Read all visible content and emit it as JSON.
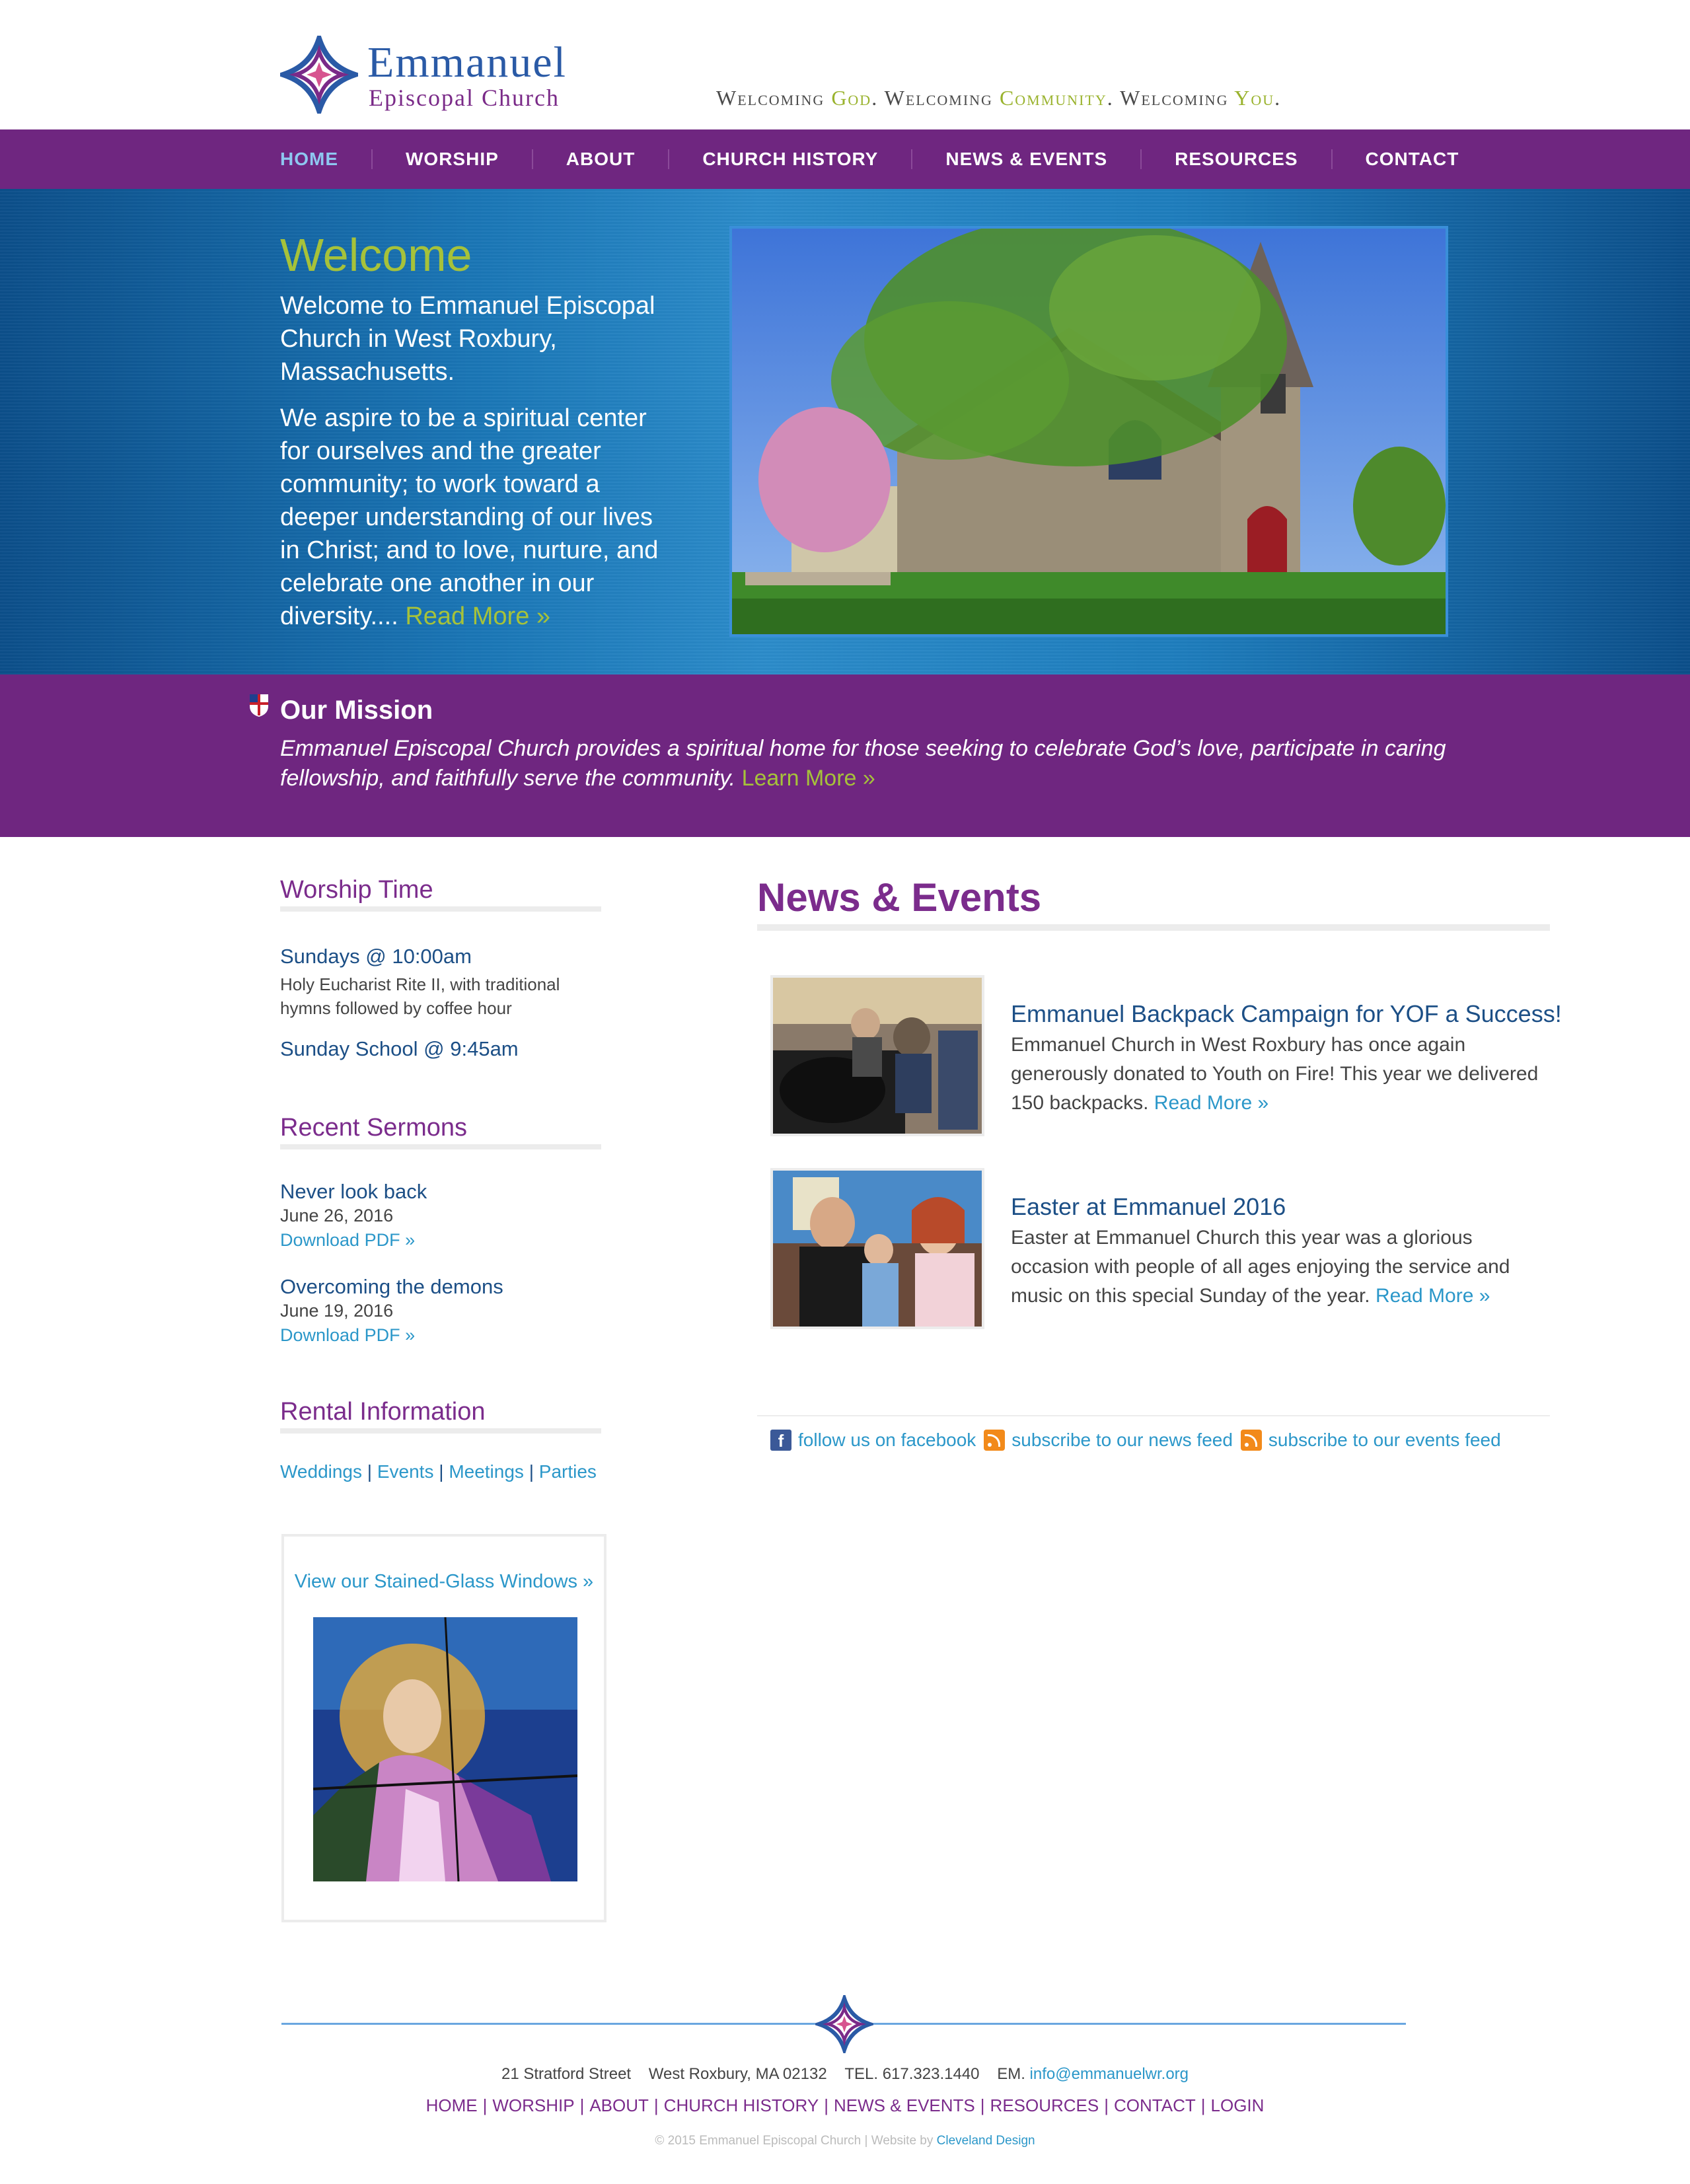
{
  "header": {
    "logo": {
      "name": "Emmanuel",
      "sub": "Episcopal Church"
    },
    "tagline": {
      "w1": "Welcoming ",
      "h1": "God",
      "p1": ". ",
      "w2": "Welcoming ",
      "h2": "Community",
      "p2": ". ",
      "w3": "Welcoming ",
      "h3": "You",
      "p3": "."
    }
  },
  "nav": {
    "items": [
      "HOME",
      "WORSHIP",
      "ABOUT",
      "CHURCH HISTORY",
      "NEWS & EVENTS",
      "RESOURCES",
      "CONTACT"
    ],
    "active": "HOME"
  },
  "hero": {
    "title": "Welcome",
    "intro": "Welcome to Emmanuel Episcopal Church in West Roxbury, Massachusetts.",
    "body": "We aspire to be a spiritual center for ourselves and the greater community; to work toward a deeper understanding of our lives in Christ; and to love, nurture, and celebrate one another in our diversity.... ",
    "read_more": "Read More »"
  },
  "mission": {
    "title": "Our Mission",
    "text": "Emmanuel Episcopal Church provides a spiritual home for those seeking to celebrate God’s love, participate in caring fellowship, and faithfully serve the community. ",
    "learn_more": "Learn More »"
  },
  "sidebar": {
    "worship": {
      "title": "Worship Time",
      "sunday": "Sundays @ 10:00am",
      "desc_line1": "Holy Eucharist Rite II, with traditional",
      "desc_line2": "hymns followed by coffee hour",
      "school": "Sunday School @ 9:45am"
    },
    "sermons": {
      "title": "Recent Sermons",
      "items": [
        {
          "title": "Never look back",
          "date": "June 26, 2016",
          "link": "Download PDF »"
        },
        {
          "title": "Overcoming the demons",
          "date": "June 19, 2016",
          "link": "Download PDF »"
        }
      ]
    },
    "rental": {
      "title": "Rental Information",
      "links": [
        "Weddings",
        "Events",
        "Meetings",
        "Parties"
      ],
      "sep": " | "
    },
    "stained": {
      "link": "View our Stained-Glass Windows »"
    }
  },
  "news": {
    "title": "News & Events",
    "items": [
      {
        "title": "Emmanuel Backpack Campaign for YOF a Success!",
        "text": "Emmanuel Church in West Roxbury has once again generously donated to Youth on Fire! This year we delivered 150 backpacks. ",
        "more": "Read More »"
      },
      {
        "title": "Easter at Emmanuel 2016",
        "text": "Easter at Emmanuel Church this year was a glorious occasion with people of all ages enjoying the service and music on this special Sunday of the year. ",
        "more": "Read More »"
      }
    ],
    "social": {
      "facebook": "follow us on facebook",
      "news_feed": "subscribe to our news feed",
      "events_feed": "subscribe to our events feed"
    }
  },
  "footer": {
    "street": "21 Stratford Street",
    "city": "West Roxbury, MA 02132",
    "tel": "TEL. 617.323.1440",
    "em_label": "EM.",
    "email": "info@emmanuelwr.org",
    "nav": [
      "HOME",
      "WORSHIP",
      "ABOUT",
      "CHURCH HISTORY",
      "NEWS & EVENTS",
      "RESOURCES",
      "CONTACT",
      "LOGIN"
    ],
    "copyright": "© 2015 Emmanuel Episcopal Church  |  Website by ",
    "designer": "Cleveland Design"
  },
  "colors": {
    "purple": "#6f2680",
    "blue": "#1c4f86",
    "green": "#a6c23a",
    "link": "#2b97c9"
  }
}
